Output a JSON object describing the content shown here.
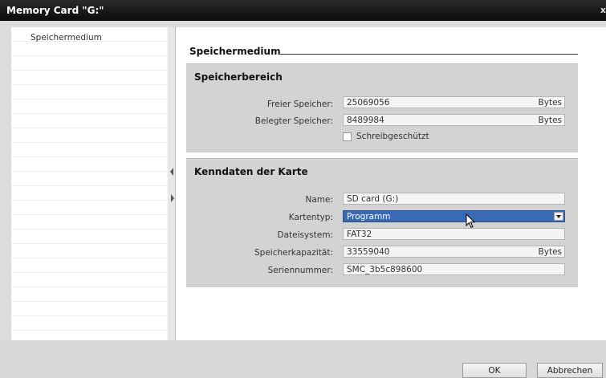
{
  "window": {
    "title": "Memory Card \"G:\"",
    "close_label": "x"
  },
  "nav": {
    "items": [
      {
        "label": "Speichermedium"
      }
    ]
  },
  "page": {
    "heading": "Speichermedium"
  },
  "speicherbereich": {
    "title": "Speicherbereich",
    "freier_label": "Freier Speicher:",
    "freier_value": "25069056",
    "freier_unit": "Bytes",
    "belegter_label": "Belegter Speicher:",
    "belegter_value": "8489984",
    "belegter_unit": "Bytes",
    "schreibgeschuetzt_label": "Schreibgeschützt",
    "schreibgeschuetzt_checked": false
  },
  "kenndaten": {
    "title": "Kenndaten der Karte",
    "name_label": "Name:",
    "name_value": "SD card (G:)",
    "kartentyp_label": "Kartentyp:",
    "kartentyp_value": "Programm",
    "dateisystem_label": "Dateisystem:",
    "dateisystem_value": "FAT32",
    "kapazitaet_label": "Speicherkapazität:",
    "kapazitaet_value": "33559040",
    "kapazitaet_unit": "Bytes",
    "seriennummer_label": "Seriennummer:",
    "seriennummer_value": "SMC_3b5c898600"
  },
  "buttons": {
    "ok": "OK",
    "abbrechen": "Abbrechen"
  },
  "colors": {
    "selection": "#3a6ab4",
    "group_bg": "#d3d3d3",
    "titlebar": "#111111"
  },
  "icons": {
    "cursor": "mouse-pointer-icon",
    "dropdown": "chevron-down-icon"
  }
}
